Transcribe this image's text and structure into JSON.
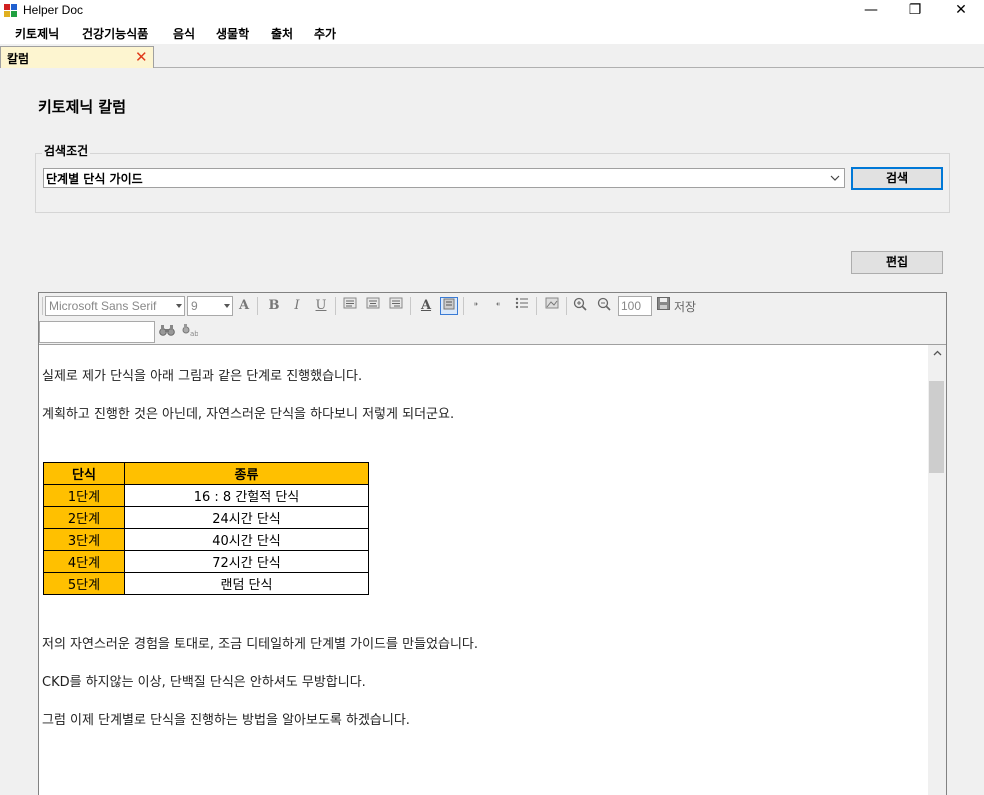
{
  "window": {
    "title": "Helper Doc"
  },
  "window_controls": {
    "minimize": "—",
    "maximize": "❐",
    "close": "✕"
  },
  "menu": [
    "키토제닉",
    "건강기능식품",
    "음식",
    "생물학",
    "출처",
    "추가"
  ],
  "tab": {
    "label": "칼럼",
    "close": "✕"
  },
  "page": {
    "title": "키토제닉 칼럼"
  },
  "search": {
    "group_label": "검색조건",
    "selected": "단계별 단식 가이드",
    "button": "검색"
  },
  "edit_button": "편집",
  "toolbar": {
    "font": "Microsoft Sans Serif",
    "size": "9",
    "zoom": "100",
    "save": "저장"
  },
  "article": {
    "paragraphs_top": [
      "실제로 제가 단식을 아래 그림과 같은 단계로 진행했습니다.",
      "계획하고 진행한 것은 아닌데, 자연스러운 단식을 하다보니 저렇게 되더군요."
    ],
    "table": {
      "headers": [
        "단식",
        "종류"
      ],
      "rows": [
        [
          "1단계",
          "16 : 8 간헐적 단식"
        ],
        [
          "2단계",
          "24시간 단식"
        ],
        [
          "3단계",
          "40시간 단식"
        ],
        [
          "4단계",
          "72시간 단식"
        ],
        [
          "5단계",
          "랜덤 단식"
        ]
      ]
    },
    "paragraphs_bottom": [
      "저의 자연스러운 경험을 토대로, 조금 디테일하게 단계별 가이드를 만들었습니다.",
      "CKD를 하지않는 이상, 단백질 단식은 안하셔도 무방합니다.",
      "그럼 이제 단계별로 단식을 진행하는 방법을 알아보도록 하겠습니다."
    ]
  }
}
